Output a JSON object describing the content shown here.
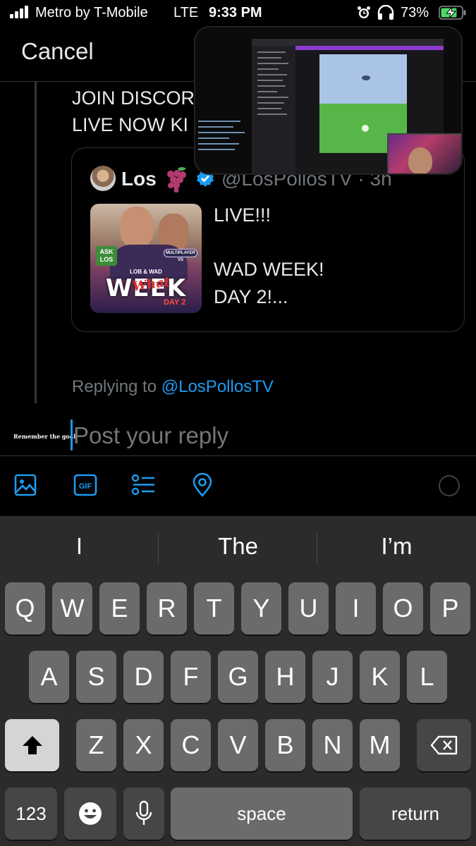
{
  "status_bar": {
    "carrier": "Metro by T-Mobile",
    "network": "LTE",
    "time": "9:33 PM",
    "battery_percent": "73%",
    "icons": [
      "signal-icon",
      "alarm-icon",
      "headphones-icon",
      "battery-charging-icon"
    ]
  },
  "header": {
    "cancel_label": "Cancel"
  },
  "post": {
    "text": "JOIN DISCOR\nLIVE NOW KI"
  },
  "quoted_post": {
    "author_name": "Los",
    "author_emoji": "🍇",
    "handle_time": "@LosPollosTV · 3h",
    "text": "LIVE!!!\n\nWAD WEEK!\nDAY 2!...",
    "thumbnail": {
      "ask_label": "ASK\nLOS",
      "badge_label": "MULTIPLAYER VS",
      "lob_label": "LOB & WAD",
      "title": "WEEK",
      "overlay_word": "What",
      "day_label": "DAY 2"
    }
  },
  "video_overlay": {
    "label": "picture-in-picture stream"
  },
  "replying": {
    "prefix": "Replying to ",
    "handle": "@LosPollosTV"
  },
  "profile_tag": "Remember the goal.",
  "reply_input": {
    "placeholder": "Post your reply",
    "value": ""
  },
  "toolbar": {
    "icons": [
      "image-icon",
      "gif-icon",
      "poll-icon",
      "location-icon"
    ],
    "gif_label": "GIF"
  },
  "keyboard": {
    "suggestions": [
      "I",
      "The",
      "I’m"
    ],
    "row1": [
      "Q",
      "W",
      "E",
      "R",
      "T",
      "Y",
      "U",
      "I",
      "O",
      "P"
    ],
    "row2": [
      "A",
      "S",
      "D",
      "F",
      "G",
      "H",
      "J",
      "K",
      "L"
    ],
    "row3": [
      "Z",
      "X",
      "C",
      "V",
      "B",
      "N",
      "M"
    ],
    "numbers_label": "123",
    "space_label": "space",
    "return_label": "return"
  },
  "colors": {
    "accent": "#1d9bf0",
    "background": "#000000",
    "keyboard_bg": "#2b2b2b"
  }
}
